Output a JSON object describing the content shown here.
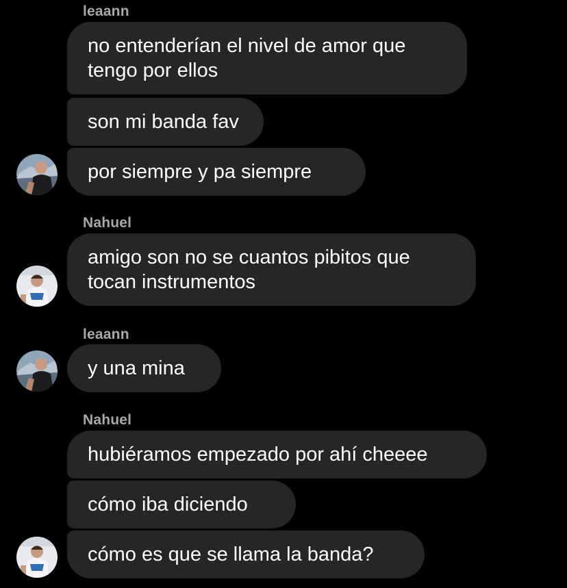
{
  "messages": [
    {
      "sender": "leaann",
      "text_lines": [
        "no entenderían el nivel de amor que",
        "tengo por ellos"
      ]
    },
    {
      "text": "son mi banda fav"
    },
    {
      "text": "por siempre y pa siempre"
    },
    {
      "sender": "Nahuel",
      "text_lines": [
        "amigo son no se cuantos pibitos que",
        "tocan instrumentos"
      ]
    },
    {
      "sender": "leaann",
      "text": "y una mina"
    },
    {
      "sender": "Nahuel",
      "text": "hubiéramos empezado por ahí cheeee"
    },
    {
      "text": "cómo iba diciendo"
    },
    {
      "text": "cómo es que se llama la banda?"
    }
  ],
  "colors": {
    "background": "#000000",
    "bubble": "#262629",
    "text": "#ffffff",
    "sender": "#a8a8a8"
  }
}
